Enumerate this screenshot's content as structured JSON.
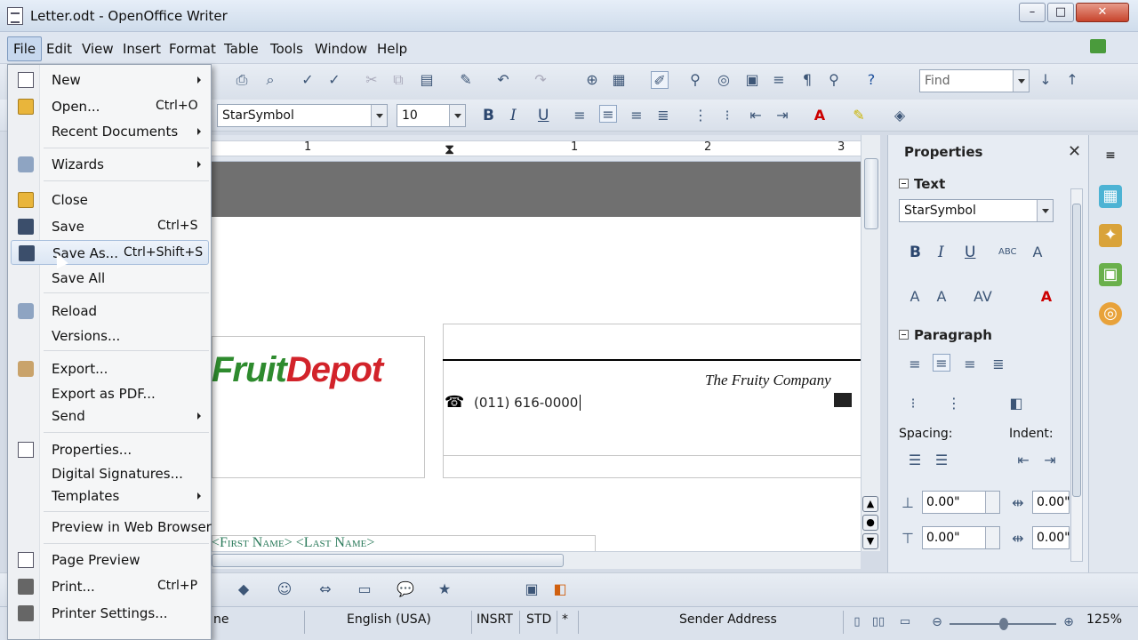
{
  "window": {
    "title": "Letter.odt - OpenOffice Writer",
    "min": "–",
    "max": "□",
    "close": "✕"
  },
  "menubar": [
    "File",
    "Edit",
    "View",
    "Insert",
    "Format",
    "Table",
    "Tools",
    "Window",
    "Help"
  ],
  "toolbar": {
    "find_placeholder": "Find",
    "font_name": "StarSymbol",
    "font_size": "10"
  },
  "ruler": {
    "marks": [
      "1",
      "1",
      "2",
      "3"
    ]
  },
  "document": {
    "logo_fruit": "Fruit",
    "logo_depot": "Depot",
    "company": "The Fruity Company",
    "phone": "(011)  616-0000",
    "recipient": "<First Name> <Last Name>"
  },
  "file_menu": [
    {
      "label": "New",
      "shortcut": "",
      "submenu": true
    },
    {
      "label": "Open...",
      "shortcut": "Ctrl+O",
      "submenu": false
    },
    {
      "label": "Recent Documents",
      "shortcut": "",
      "submenu": true
    },
    {
      "label": "Wizards",
      "shortcut": "",
      "submenu": true
    },
    {
      "label": "Close",
      "shortcut": "",
      "submenu": false
    },
    {
      "label": "Save",
      "shortcut": "Ctrl+S",
      "submenu": false
    },
    {
      "label": "Save As...",
      "shortcut": "Ctrl+Shift+S",
      "submenu": false
    },
    {
      "label": "Save All",
      "shortcut": "",
      "submenu": false
    },
    {
      "label": "Reload",
      "shortcut": "",
      "submenu": false
    },
    {
      "label": "Versions...",
      "shortcut": "",
      "submenu": false
    },
    {
      "label": "Export...",
      "shortcut": "",
      "submenu": false
    },
    {
      "label": "Export as PDF...",
      "shortcut": "",
      "submenu": false
    },
    {
      "label": "Send",
      "shortcut": "",
      "submenu": true
    },
    {
      "label": "Properties...",
      "shortcut": "",
      "submenu": false
    },
    {
      "label": "Digital Signatures...",
      "shortcut": "",
      "submenu": false
    },
    {
      "label": "Templates",
      "shortcut": "",
      "submenu": true
    },
    {
      "label": "Preview in Web Browser",
      "shortcut": "",
      "submenu": false
    },
    {
      "label": "Page Preview",
      "shortcut": "",
      "submenu": false
    },
    {
      "label": "Print...",
      "shortcut": "Ctrl+P",
      "submenu": false
    },
    {
      "label": "Printer Settings...",
      "shortcut": "",
      "submenu": false
    }
  ],
  "sidebar": {
    "title": "Properties",
    "close": "✕",
    "text_section": "Text",
    "font_name": "StarSymbol",
    "paragraph_section": "Paragraph",
    "spacing_label": "Spacing:",
    "indent_label": "Indent:",
    "spacing_above": "0.00\"",
    "spacing_below": "0.00\"",
    "indent_before": "0.00\"",
    "indent_after": "0.00\""
  },
  "statusbar": {
    "page_style": "ne",
    "language": "English (USA)",
    "insert_mode": "INSRT",
    "selection_mode": "STD",
    "modified": "*",
    "section": "Sender Address",
    "zoom": "125%"
  },
  "colors": {
    "highlight": "#dbe6f4",
    "logo_green": "#2e8b2e",
    "logo_red": "#d2232a"
  }
}
